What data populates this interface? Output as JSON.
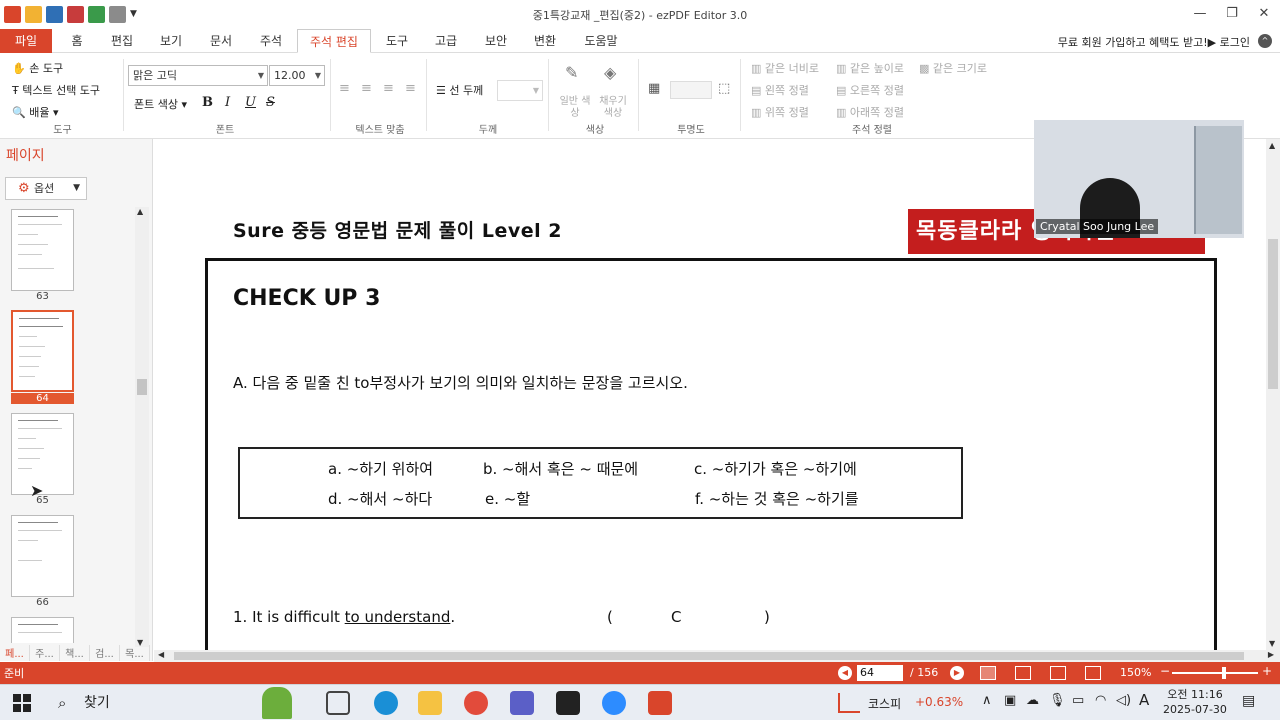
{
  "window": {
    "title": "중1특강교재 _편집(중2) - ezPDF Editor 3.0",
    "controls": {
      "minimize": "—",
      "restore": "❐",
      "close": "✕"
    }
  },
  "tabs": [
    {
      "label": "파일"
    },
    {
      "label": "홈"
    },
    {
      "label": "편집"
    },
    {
      "label": "보기"
    },
    {
      "label": "문서"
    },
    {
      "label": "주석"
    },
    {
      "label": "주석 편집"
    },
    {
      "label": "도구"
    },
    {
      "label": "고급"
    },
    {
      "label": "보안"
    },
    {
      "label": "변환"
    },
    {
      "label": "도움말"
    }
  ],
  "active_tab": "주석 편집",
  "promo": {
    "text": "무료 회원 가입하고 혜택도 받고!▶ 로그인"
  },
  "ribbon": {
    "tools": {
      "hand": "손 도구",
      "text_select": "텍스트 선택 도구",
      "zoom": "배율",
      "label": "도구"
    },
    "font": {
      "family": "맑은 고딕",
      "size": "12.00",
      "color_label": "폰트 색상",
      "bold": "B",
      "italic": "I",
      "underline": "U",
      "strike": "S",
      "label": "폰트"
    },
    "align": {
      "label": "텍스트 맞춤"
    },
    "thickness": {
      "line": "선 두께",
      "label": "두께"
    },
    "color": {
      "normal": "일반 색상",
      "fill": "채우기 색상",
      "label": "색상"
    },
    "opacity": {
      "label": "투명도"
    },
    "arrange": {
      "same_width": "같은 너비로",
      "same_height": "같은 높이로",
      "same_size": "같은 크기로",
      "align_left": "왼쪽 정렬",
      "align_right": "오른쪽 정렬",
      "align_top": "위쪽 정렬",
      "align_bottom": "아래쪽 정렬",
      "label": "주석 정렬"
    }
  },
  "sidebar": {
    "title": "페이지",
    "options": "옵션",
    "pages": [
      {
        "num": "63"
      },
      {
        "num": "64"
      },
      {
        "num": "65"
      },
      {
        "num": "66"
      }
    ],
    "selected_page": "64",
    "bottom_tabs": [
      "페...",
      "주...",
      "책...",
      "검...",
      "목..."
    ]
  },
  "document": {
    "header": "Sure 중등 영문법 문제 풀이 Level 2",
    "logo": "목동클라라 영어학원",
    "section": "CHECK UP 3",
    "instruction": "A. 다음 중 밑줄 친 to부정사가 보기의 의미와 일치하는 문장을 고르시오.",
    "choices": {
      "a": "a. ~하기 위하여",
      "b": "b. ~해서 혹은 ~ 때문에",
      "c": "c. ~하기가 혹은 ~하기에",
      "d": "d. ~해서 ~하다",
      "e": "e. ~할",
      "f": "f. ~하는 것 혹은 ~하기를"
    },
    "item1": {
      "pre": "1. It is difficult ",
      "underlined": "to understand",
      "post": ".",
      "open": "(",
      "answer": "C",
      "close": ")"
    }
  },
  "video": {
    "name": "Cryatal Soo Jung Lee"
  },
  "status": {
    "ready": "준비",
    "page_current": "64",
    "page_total": "/ 156",
    "zoom": "150%",
    "zoom_minus": "−",
    "zoom_plus": "+"
  },
  "taskbar": {
    "search": "찾기",
    "kospi_label": "코스피",
    "kospi_change": "+0.63%",
    "clock_time": "오전 11:16",
    "clock_date": "2025-07-30",
    "ime": "A"
  },
  "colors": {
    "accent": "#d9452b",
    "logo_red": "#c41e1e",
    "kospi_red": "#d9452b"
  }
}
